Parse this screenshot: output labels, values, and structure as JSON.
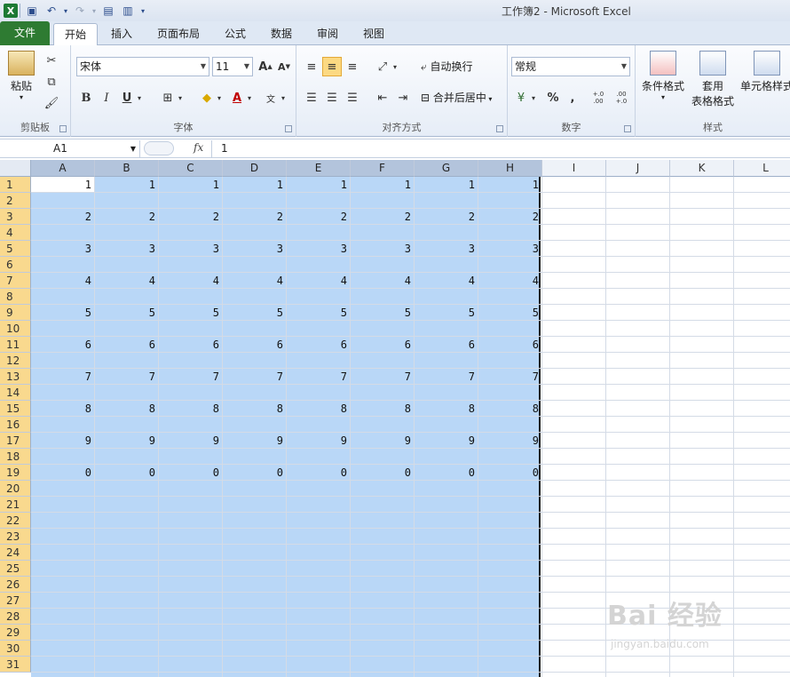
{
  "window": {
    "title": "工作簿2 - Microsoft Excel",
    "app_icon": "X"
  },
  "tabs": [
    "文件",
    "开始",
    "插入",
    "页面布局",
    "公式",
    "数据",
    "审阅",
    "视图"
  ],
  "ribbon": {
    "clipboard": {
      "label": "剪贴板",
      "paste": "粘贴"
    },
    "font": {
      "label": "字体",
      "name": "宋体",
      "size": "11",
      "bold": "B",
      "italic": "I",
      "underline": "U",
      "grow": "A",
      "shrink": "A"
    },
    "align": {
      "label": "对齐方式",
      "wrap": "自动换行",
      "merge": "合并后居中"
    },
    "number": {
      "label": "数字",
      "format": "常规",
      "percent": "%",
      "comma": ",",
      "inc": "+.0 .00",
      "dec": ".00 +.0"
    },
    "styles": {
      "label": "样式",
      "cond": "条件格式",
      "table1": "套用",
      "table2": "表格格式",
      "cell": "单元格样式"
    }
  },
  "formula_bar": {
    "name_box": "A1",
    "fx": "fx",
    "value": "1"
  },
  "columns": [
    "A",
    "B",
    "C",
    "D",
    "E",
    "F",
    "G",
    "H",
    "I",
    "J",
    "K",
    "L"
  ],
  "rows": [
    "1",
    "2",
    "3",
    "4",
    "5",
    "6",
    "7",
    "8",
    "9",
    "10",
    "11",
    "12",
    "13",
    "14",
    "15",
    "16",
    "17",
    "18",
    "19",
    "20",
    "21",
    "22",
    "23",
    "24",
    "25",
    "26",
    "27",
    "28",
    "29",
    "30",
    "31"
  ],
  "cells": [
    {
      "row": 1,
      "value": "1"
    },
    {
      "row": 3,
      "value": "2"
    },
    {
      "row": 5,
      "value": "3"
    },
    {
      "row": 7,
      "value": "4"
    },
    {
      "row": 9,
      "value": "5"
    },
    {
      "row": 11,
      "value": "6"
    },
    {
      "row": 13,
      "value": "7"
    },
    {
      "row": 15,
      "value": "8"
    },
    {
      "row": 17,
      "value": "9"
    },
    {
      "row": 19,
      "value": "0"
    }
  ],
  "selection": {
    "range": "A1:H31",
    "active_cell": "A1"
  },
  "colors": {
    "selection": "#b9d7f7",
    "file_tab": "#2e7b32",
    "row_header_highlight": "#f9d98e"
  },
  "watermark": {
    "brand": "Bai 经验",
    "url": "jingyan.baidu.com"
  }
}
